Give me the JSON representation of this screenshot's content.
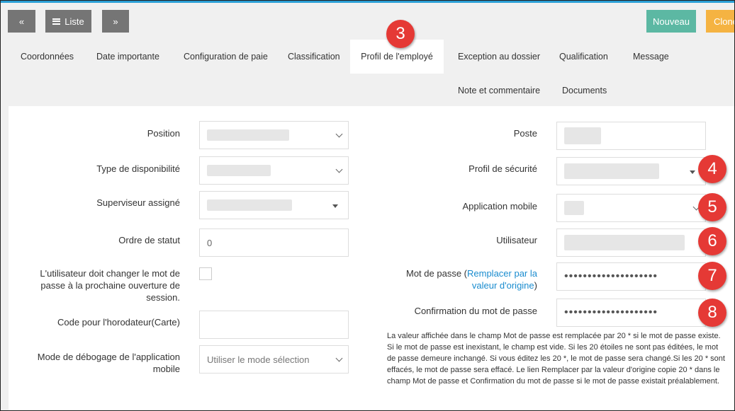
{
  "toolbar": {
    "prev_icon": "«",
    "list_label": "Liste",
    "next_icon": "»",
    "new_label": "Nouveau",
    "clone_label": "Clone"
  },
  "tabs": [
    {
      "label": "Coordonnées"
    },
    {
      "label": "Date importante"
    },
    {
      "label": "Configuration de paie"
    },
    {
      "label": "Classification"
    },
    {
      "label": "Profil de l'employé",
      "active": true
    },
    {
      "label": "Exception au dossier"
    },
    {
      "label": "Qualification"
    },
    {
      "label": "Message"
    },
    {
      "label": "Note et commentaire"
    },
    {
      "label": "Documents"
    }
  ],
  "form": {
    "position_label": "Position",
    "disponibilite_label": "Type de disponibilité",
    "superviseur_label": "Superviseur assigné",
    "ordre_label": "Ordre de statut",
    "ordre_value": "0",
    "changer_mdp_label": "L'utilisateur doit changer le mot de passe à la prochaine ouverture de session.",
    "code_label": "Code pour l'horodateur(Carte)",
    "debogage_label": "Mode de débogage de l'application mobile",
    "debogage_value": "Utiliser le mode sélection",
    "poste_label": "Poste",
    "profil_securite_label": "Profil de sécurité",
    "app_mobile_label": "Application mobile",
    "utilisateur_label": "Utilisateur",
    "mdp_label": "Mot de passe (",
    "mdp_link": "Remplacer par la valeur d'origine",
    "mdp_close": ")",
    "mdp_value": "••••••••••••••••••••",
    "confirm_label": "Confirmation du mot de passe",
    "confirm_value": "••••••••••••••••••••",
    "note": "La valeur affichée dans le champ Mot de passe est remplacée par 20 * si le mot de passe existe. Si le mot de passe est inexistant, le champ est vide. Si les 20 étoiles ne sont pas éditées, le mot de passe demeure inchangé. Si vous éditez les 20 *, le mot de passe sera changé.Si les 20 * sont effacés, le mot de passe sera effacé. Le lien Remplacer par la valeur d'origine copie 20 * dans le champ Mot de passe et Confirmation du mot de passe si le mot de passe existait préalablement."
  },
  "badges": [
    "3",
    "4",
    "5",
    "6",
    "7",
    "8"
  ],
  "colors": {
    "accent_line": "#2a9fd6",
    "button_gray": "#757575",
    "button_green": "#5cb8a3",
    "button_orange": "#f5b342",
    "link": "#1a8ccf",
    "badge_red": "#e53935"
  }
}
